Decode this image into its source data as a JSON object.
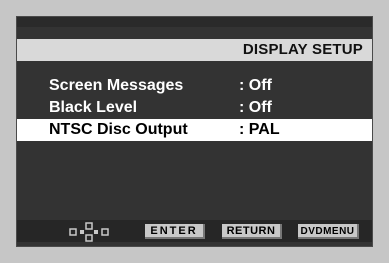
{
  "header": {
    "title": "DISPLAY SETUP"
  },
  "menu": {
    "items": [
      {
        "label": "Screen Messages",
        "value": ": Off",
        "selected": false
      },
      {
        "label": "Black Level",
        "value": ": Off",
        "selected": false
      },
      {
        "label": "NTSC Disc Output",
        "value": ": PAL",
        "selected": true
      }
    ]
  },
  "footer": {
    "nav_icon": "navigation-arrows-icon",
    "enter_label": "ENTER",
    "return_label": "RETURN",
    "dvdmenu_label": "DVDMENU"
  },
  "colors": {
    "screen_bg": "#333333",
    "title_band": "#d9d9d9",
    "selected_row": "#ffffff",
    "frame": "#c6c6c6"
  }
}
